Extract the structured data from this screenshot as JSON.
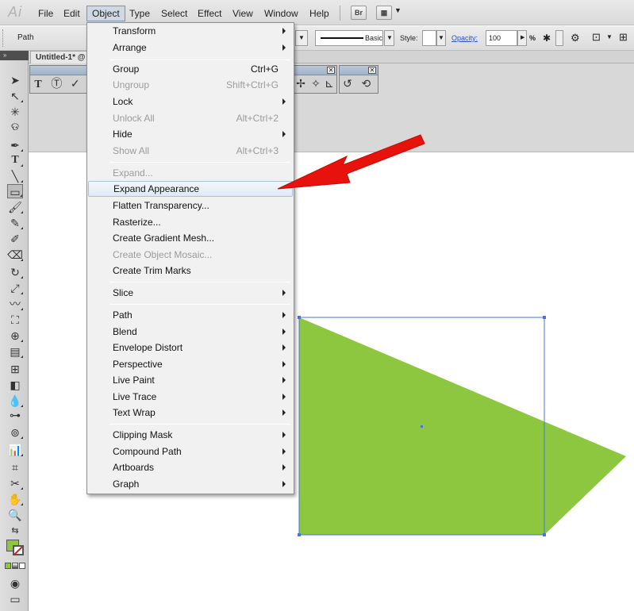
{
  "app": {
    "logo": "Ai"
  },
  "menubar": {
    "items": [
      "File",
      "Edit",
      "Object",
      "Type",
      "Select",
      "Effect",
      "View",
      "Window",
      "Help"
    ],
    "bridge_label": "Br"
  },
  "control": {
    "selection": "Path",
    "stroke_profile": "Basic",
    "style_label": "Style:",
    "opacity_label": "Opacity:",
    "opacity_value": "100",
    "opacity_unit": "%"
  },
  "document": {
    "tab_title": "Untitled-1* @"
  },
  "object_menu": {
    "items": [
      {
        "label": "Transform",
        "submenu": true
      },
      {
        "label": "Arrange",
        "submenu": true
      },
      {
        "label": "Group",
        "shortcut": "Ctrl+G"
      },
      {
        "label": "Ungroup",
        "shortcut": "Shift+Ctrl+G",
        "disabled": true
      },
      {
        "label": "Lock",
        "submenu": true
      },
      {
        "label": "Unlock All",
        "shortcut": "Alt+Ctrl+2",
        "disabled": true
      },
      {
        "label": "Hide",
        "submenu": true
      },
      {
        "label": "Show All",
        "shortcut": "Alt+Ctrl+3",
        "disabled": true
      },
      {
        "label": "Expand...",
        "disabled": true
      },
      {
        "label": "Expand Appearance",
        "highlighted": true
      },
      {
        "label": "Flatten Transparency..."
      },
      {
        "label": "Rasterize..."
      },
      {
        "label": "Create Gradient Mesh..."
      },
      {
        "label": "Create Object Mosaic...",
        "disabled": true
      },
      {
        "label": "Create Trim Marks"
      },
      {
        "label": "Slice",
        "submenu": true
      },
      {
        "label": "Path",
        "submenu": true
      },
      {
        "label": "Blend",
        "submenu": true
      },
      {
        "label": "Envelope Distort",
        "submenu": true
      },
      {
        "label": "Perspective",
        "submenu": true
      },
      {
        "label": "Live Paint",
        "submenu": true
      },
      {
        "label": "Live Trace",
        "submenu": true
      },
      {
        "label": "Text Wrap",
        "submenu": true
      },
      {
        "label": "Clipping Mask",
        "submenu": true
      },
      {
        "label": "Compound Path",
        "submenu": true
      },
      {
        "label": "Artboards",
        "submenu": true
      },
      {
        "label": "Graph",
        "submenu": true
      }
    ]
  },
  "colors": {
    "shape_fill": "#8dc63f",
    "selection": "#4a74d6",
    "annotation_arrow": "#e8120c",
    "menu_highlight": "#dfe9f5"
  },
  "icons": {
    "fill_swatch": "green-fill-swatch-icon",
    "stroke_swatch": "no-stroke-swatch-icon"
  }
}
